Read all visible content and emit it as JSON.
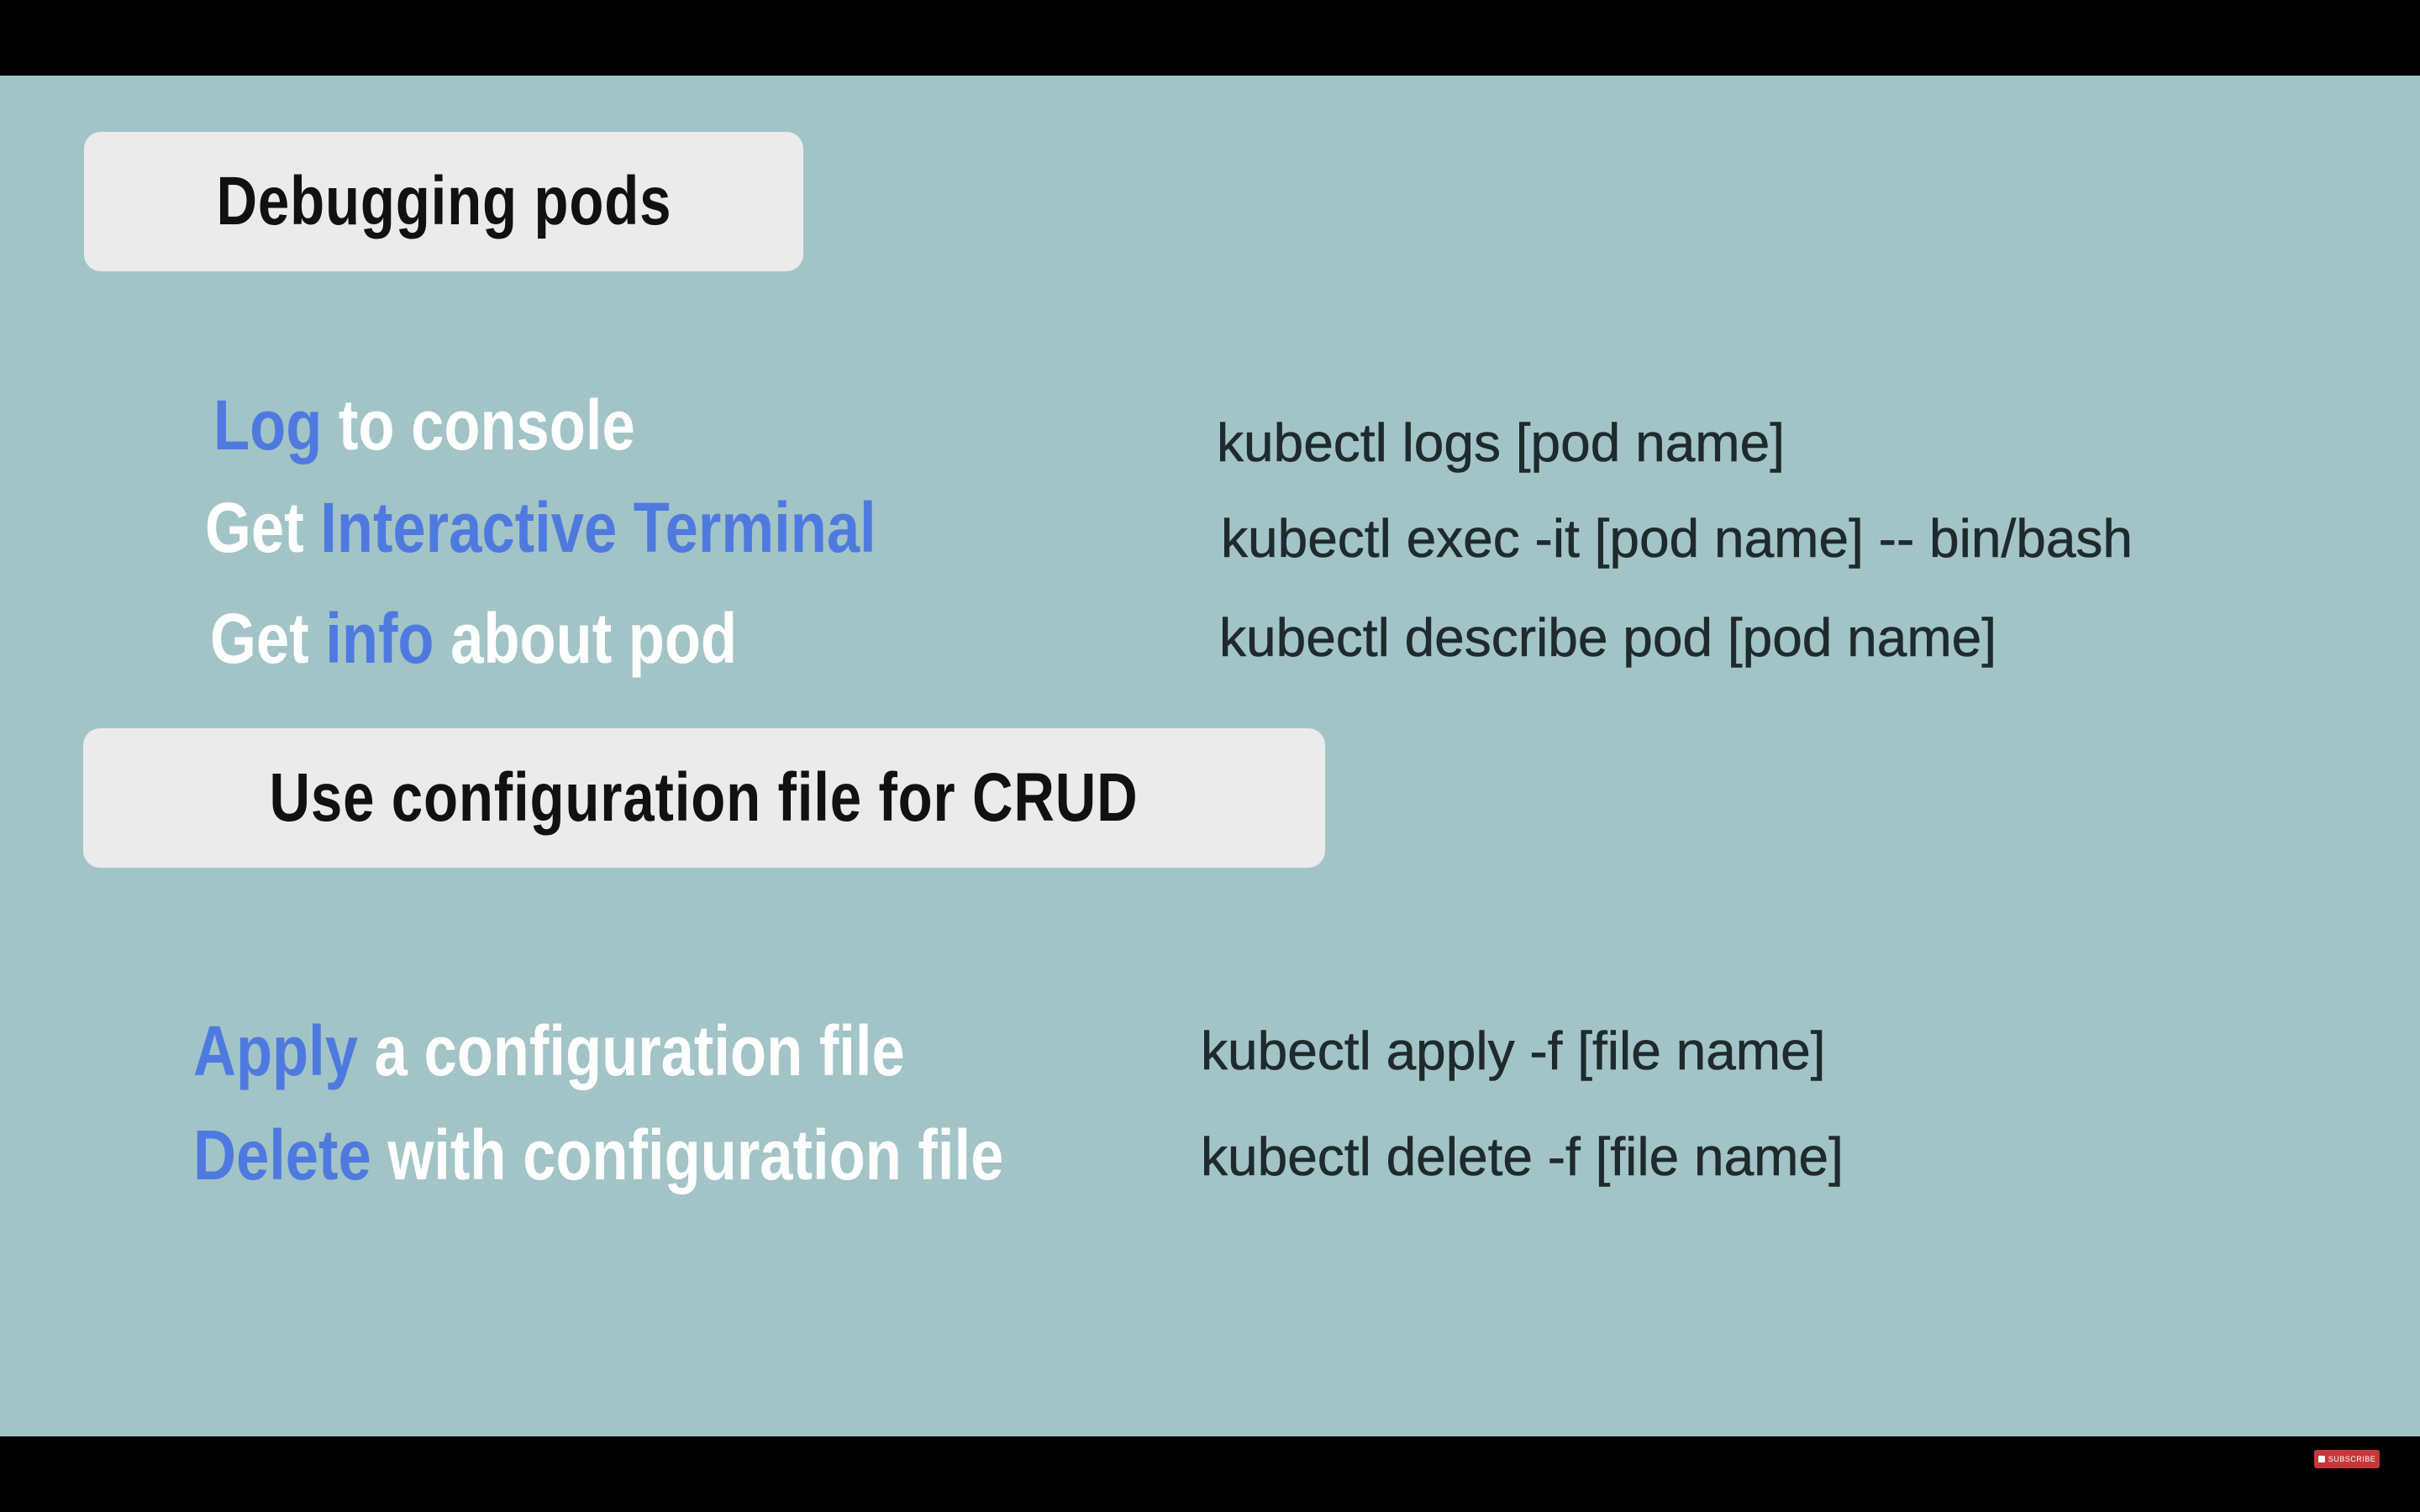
{
  "slide": {
    "background": "#a2c4c7",
    "highlight_color": "#4e7ae0"
  },
  "sections": [
    {
      "title": "Debugging pods",
      "rows": [
        {
          "parts": [
            {
              "text": "Log",
              "hl": true
            },
            {
              "text": " to console",
              "hl": false
            }
          ],
          "command": "kubectl logs [pod name]"
        },
        {
          "parts": [
            {
              "text": "Get ",
              "hl": false
            },
            {
              "text": "Interactive Terminal",
              "hl": true
            }
          ],
          "command": "kubectl exec -it [pod name] -- bin/bash"
        },
        {
          "parts": [
            {
              "text": "Get ",
              "hl": false
            },
            {
              "text": "info",
              "hl": true
            },
            {
              "text": " about pod",
              "hl": false
            }
          ],
          "command": "kubectl describe pod [pod name]"
        }
      ]
    },
    {
      "title": "Use configuration file for CRUD",
      "rows": [
        {
          "parts": [
            {
              "text": "Apply",
              "hl": true
            },
            {
              "text": " a configuration file",
              "hl": false
            }
          ],
          "command": "kubectl apply -f [file name]"
        },
        {
          "parts": [
            {
              "text": "Delete",
              "hl": true
            },
            {
              "text": " with configuration file",
              "hl": false
            }
          ],
          "command": "kubectl delete -f [file name]"
        }
      ]
    }
  ],
  "player": {
    "subscribe_label": "SUBSCRIBE"
  }
}
